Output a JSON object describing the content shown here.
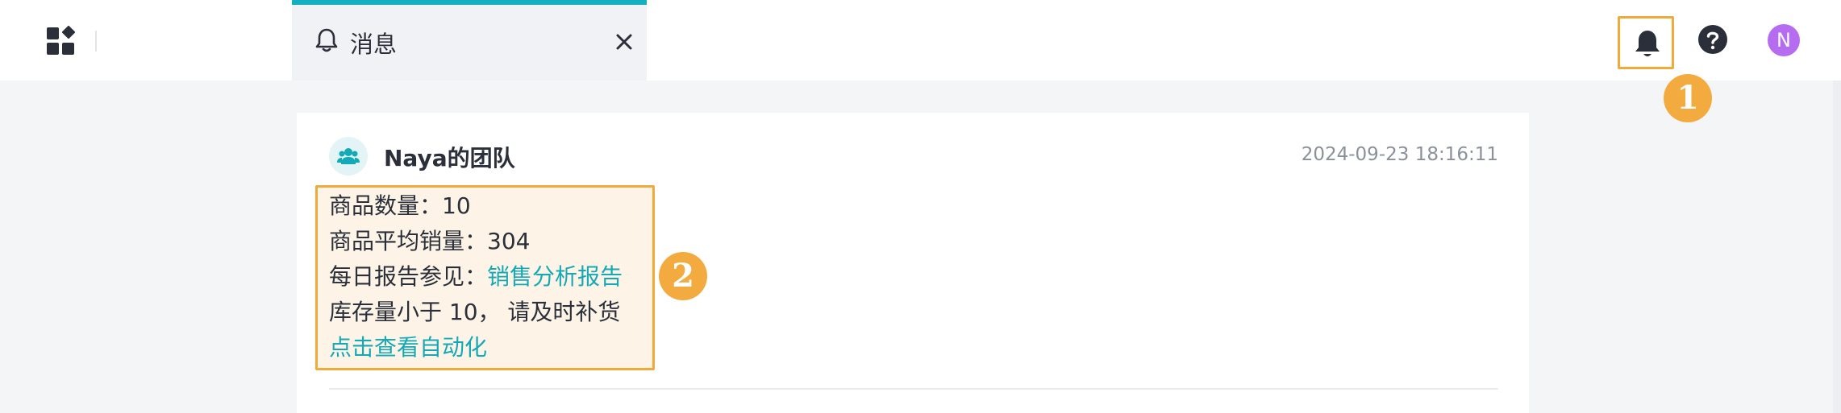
{
  "topbar": {
    "app_icon": "apps-grid-icon",
    "tab": {
      "icon": "bell-icon",
      "label": "消息",
      "close_icon": "close-icon"
    },
    "notifications_icon": "bell-icon",
    "help_icon": "help-circle-icon",
    "avatar_letter": "N"
  },
  "markers": {
    "first": "1",
    "second": "2"
  },
  "message": {
    "sender": "Naya的团队",
    "sender_icon": "team-icon",
    "timestamp": "2024-09-23 18:16:11",
    "lines": {
      "product_count": "商品数量：10",
      "avg_sales": "商品平均销量：304",
      "daily_report_prefix": "每日报告参见：",
      "daily_report_link": "销售分析报告",
      "stock_warning": "库存量小于 10， 请及时补货",
      "automation_link": "点击查看自动化"
    }
  },
  "colors": {
    "accent": "#13b0bf",
    "link": "#13a9b6",
    "highlight": "#f0a93b",
    "avatar": "#b56cf0"
  }
}
